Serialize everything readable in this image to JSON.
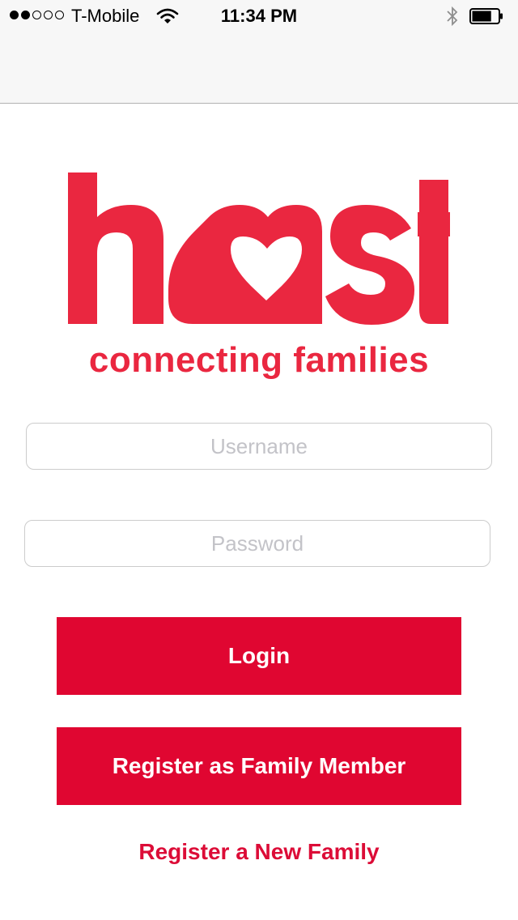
{
  "status_bar": {
    "carrier": "T-Mobile",
    "time": "11:34 PM",
    "signal_strength": 2,
    "signal_max": 5,
    "battery_level": 0.75
  },
  "brand": {
    "logo_text": "host",
    "tagline": "connecting families",
    "color": "#ea2740"
  },
  "form": {
    "username_placeholder": "Username",
    "username_value": "",
    "password_placeholder": "Password",
    "password_value": ""
  },
  "actions": {
    "login_label": "Login",
    "register_member_label": "Register as Family Member",
    "register_family_label": "Register a New Family",
    "button_color": "#e00631"
  },
  "icons": {
    "wifi": "wifi-icon",
    "bluetooth": "bluetooth-icon",
    "battery": "battery-icon",
    "signal": "signal-dots-icon"
  }
}
